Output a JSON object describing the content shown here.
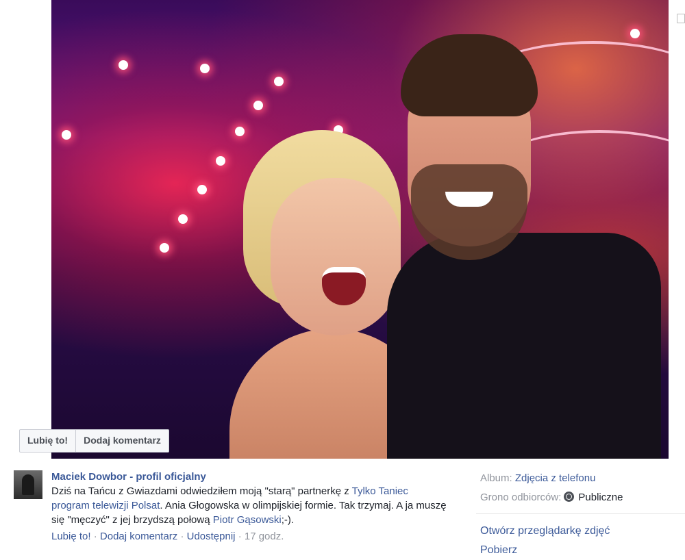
{
  "photo": {
    "actions": {
      "like": "Lubię to!",
      "comment": "Dodaj komentarz"
    }
  },
  "post": {
    "author": "Maciek Dowbor - profil oficjalny",
    "text_1": "Dziś na Tańcu z Gwiazdami odwiedziłem moją \"starą\" partnerkę z ",
    "link_1": "Tylko Taniec program telewizji Polsat",
    "text_2": ". Ania Głogowska w olimpijskiej formie. Tak trzymaj. A ja muszę się \"męczyć\" z jej brzydszą połową ",
    "link_2": "Piotr Gąsowski",
    "text_3": ";-).",
    "actions": {
      "like": "Lubię to!",
      "comment": "Dodaj komentarz",
      "share": "Udostępnij",
      "time": "17 godz."
    },
    "separator": "·"
  },
  "sidebar": {
    "album_label": "Album:",
    "album_value": "Zdjęcia z telefonu",
    "audience_label": "Grono odbiorców:",
    "audience_value": "Publiczne",
    "browser_link": "Otwórz przeglądarkę zdjęć",
    "download_link": "Pobierz"
  }
}
